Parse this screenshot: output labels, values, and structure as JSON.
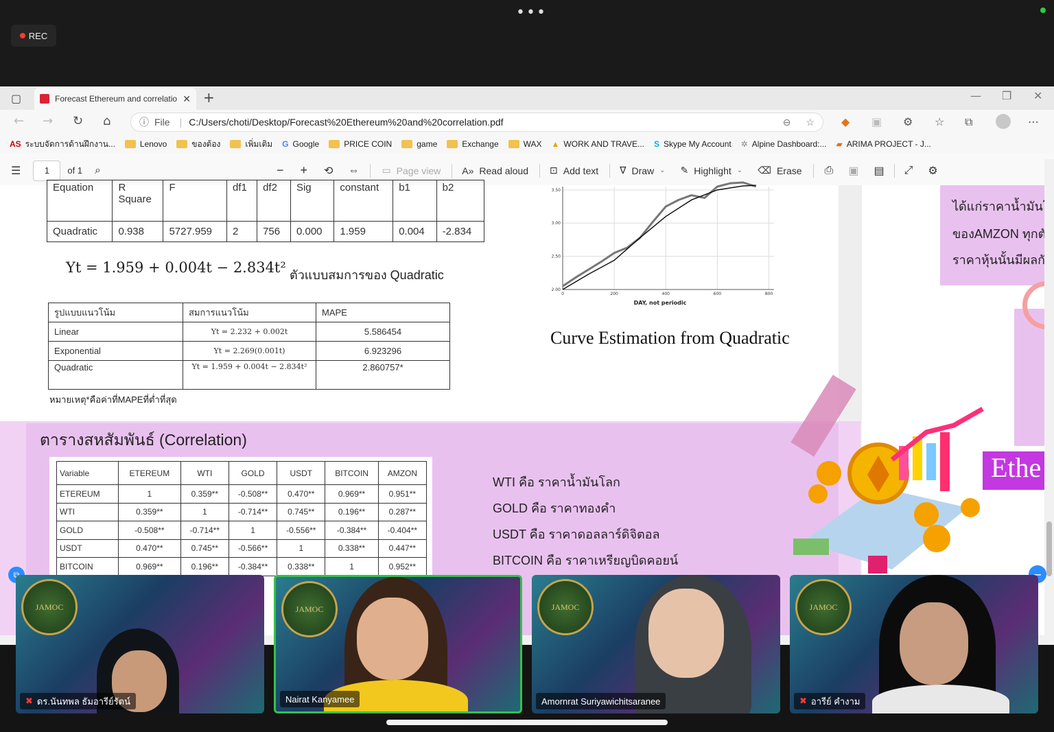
{
  "meeting": {
    "rec_label": "REC"
  },
  "browser": {
    "tab_title": "Forecast Ethereum and correlatio",
    "url_prefix": "File",
    "url": "C:/Users/choti/Desktop/Forecast%20Ethereum%20and%20correlation.pdf",
    "bookmarks": [
      "ระบบจัดการด้านฝึกงาน...",
      "Lenovo",
      "ของต้อง",
      "เพิ่มเติม",
      "Google",
      "PRICE COIN",
      "game",
      "Exchange",
      "WAX",
      "WORK AND TRAVE...",
      "Skype My Account",
      "Alpine Dashboard:...",
      "ARIMA PROJECT - J..."
    ]
  },
  "pdf_toolbar": {
    "page_num": "1",
    "page_total": "of 1",
    "page_view": "Page view",
    "read_aloud": "Read aloud",
    "add_text": "Add text",
    "draw": "Draw",
    "highlight": "Highlight",
    "erase": "Erase"
  },
  "regression_table": {
    "headers": [
      "Equation",
      "R Square",
      "F",
      "df1",
      "df2",
      "Sig",
      "constant",
      "b1",
      "b2"
    ],
    "row": [
      "Quadratic",
      "0.938",
      "5727.959",
      "2",
      "756",
      "0.000",
      "1.959",
      "0.004",
      "-2.834"
    ]
  },
  "equation": {
    "text": "Yt = 1.959 + 0.004t − 2.834t²",
    "label": "ตัวแบบสมการของ Quadratic"
  },
  "mape_table": {
    "headers": [
      "รูปแบบแนวโน้ม",
      "สมการแนวโน้ม",
      "MAPE"
    ],
    "rows": [
      [
        "Linear",
        "Yt = 2.232 + 0.002t",
        "5.586454"
      ],
      [
        "Exponential",
        "Yt = 2.269(0.001t)",
        "6.923296"
      ],
      [
        "Quadratic",
        "Yt = 1.959 + 0.004t − 2.834t²",
        "2.860757*"
      ]
    ],
    "note": "หมายเหตุ*คือค่าที่MAPEที่ต่ำที่สุด"
  },
  "chart_data": {
    "type": "line",
    "title": "Curve Estimation from Quadratic",
    "xlabel": "DAY, not periodic",
    "x_ticks": [
      "0",
      "200",
      "400",
      "600",
      "800"
    ],
    "y_ticks": [
      "2.00",
      "2.50",
      "3.00",
      "3.50"
    ],
    "xlim": [
      0,
      820
    ],
    "ylim": [
      2.0,
      3.55
    ],
    "series": [
      {
        "x": [
          0,
          50,
          100,
          150,
          200,
          250,
          300,
          350,
          400,
          450,
          500,
          550,
          600,
          650,
          700,
          750
        ],
        "y": [
          2.05,
          2.18,
          2.3,
          2.42,
          2.55,
          2.63,
          2.78,
          3.02,
          3.25,
          3.35,
          3.42,
          3.38,
          3.55,
          3.6,
          3.65,
          3.55
        ]
      },
      {
        "x": [
          0,
          100,
          200,
          300,
          400,
          500,
          600,
          700,
          750
        ],
        "y": [
          2.0,
          2.23,
          2.44,
          2.78,
          3.1,
          3.35,
          3.5,
          3.56,
          3.57
        ]
      }
    ]
  },
  "correlation": {
    "title": "ตารางสหสัมพันธ์ (Correlation)",
    "headers": [
      "Variable",
      "ETEREUM",
      "WTI",
      "GOLD",
      "USDT",
      "BITCOIN",
      "AMZON"
    ],
    "rows": [
      [
        "ETEREUM",
        "1",
        "0.359**",
        "-0.508**",
        "0.470**",
        "0.969**",
        "0.951**"
      ],
      [
        "WTI",
        "0.359**",
        "1",
        "-0.714**",
        "0.745**",
        "0.196**",
        "0.287**"
      ],
      [
        "GOLD",
        "-0.508**",
        "-0.714**",
        "1",
        "-0.556**",
        "-0.384**",
        "-0.404**"
      ],
      [
        "USDT",
        "0.470**",
        "0.745**",
        "-0.566**",
        "1",
        "0.338**",
        "0.447**"
      ],
      [
        "BITCOIN",
        "0.969**",
        "0.196**",
        "-0.384**",
        "0.338**",
        "1",
        "0.952**"
      ]
    ],
    "legend": [
      "WTI คือ ราคาน้ำมันโลก",
      "GOLD คือ ราคาทองคำ",
      "USDT คือ ราคาดอลลาร์ดิจิตอล",
      "BITCOIN คือ ราคาเหรียญบิดคอยน์"
    ]
  },
  "right_panel": {
    "lines": [
      "ได้แก่ราคาน้ำมันโล",
      "ของAMZON ทุกตั",
      "ราคาหุ้นนั้นมีผลกั"
    ],
    "banner": "Ethe"
  },
  "participants": [
    {
      "name": "ดร.นันทพล ธัมอารีย์รัตน์",
      "muted": true
    },
    {
      "name": "Nairat Kanyamee",
      "muted": false
    },
    {
      "name": "Amornrat Suriyawichitsaranee",
      "muted": false
    },
    {
      "name": "อารีย์ คำงาม",
      "muted": true
    }
  ]
}
